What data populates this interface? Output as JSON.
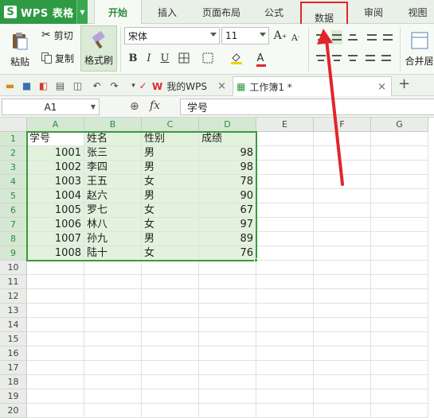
{
  "app": {
    "name": "WPS 表格",
    "logo": "S"
  },
  "menu_tabs": [
    {
      "label": "开始",
      "active": true
    },
    {
      "label": "插入"
    },
    {
      "label": "页面布局"
    },
    {
      "label": "公式"
    },
    {
      "label": "数据",
      "highlighted": true
    },
    {
      "label": "审阅"
    },
    {
      "label": "视图"
    }
  ],
  "ribbon": {
    "paste": "粘贴",
    "cut": "剪切",
    "copy": "复制",
    "format_painter": "格式刷",
    "font_name": "宋体",
    "font_size": "11",
    "merge_center": "合并居"
  },
  "doc_tabs": [
    {
      "label": "我的WPS"
    },
    {
      "label": "工作簿1 *",
      "active": true
    }
  ],
  "formula_bar": {
    "name_box": "A1",
    "fx": "fx",
    "content": "学号"
  },
  "columns": [
    "A",
    "B",
    "C",
    "D",
    "E",
    "F",
    "G"
  ],
  "rows": [
    "1",
    "2",
    "3",
    "4",
    "5",
    "6",
    "7",
    "8",
    "9",
    "10",
    "11",
    "12",
    "13",
    "14",
    "15",
    "16",
    "17",
    "18",
    "19",
    "20"
  ],
  "table": {
    "headers": [
      "学号",
      "姓名",
      "性别",
      "成绩"
    ],
    "records": [
      [
        "1001",
        "张三",
        "男",
        "98"
      ],
      [
        "1002",
        "李四",
        "男",
        "98"
      ],
      [
        "1003",
        "王五",
        "女",
        "78"
      ],
      [
        "1004",
        "赵六",
        "男",
        "90"
      ],
      [
        "1005",
        "罗七",
        "女",
        "67"
      ],
      [
        "1006",
        "林八",
        "女",
        "97"
      ],
      [
        "1007",
        "孙九",
        "男",
        "89"
      ],
      [
        "1008",
        "陆十",
        "女",
        "76"
      ]
    ]
  },
  "colors": {
    "accent": "#2f9a44",
    "selection": "#3a9a3a",
    "annotation": "#e0262b"
  }
}
